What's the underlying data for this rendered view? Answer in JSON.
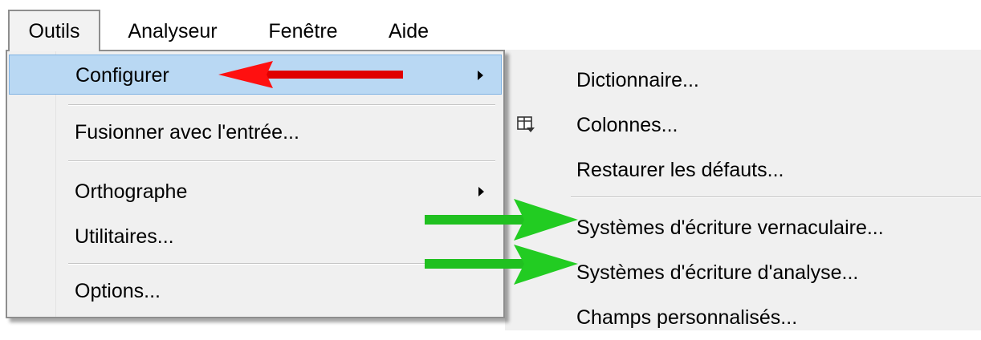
{
  "menubar": {
    "items": [
      {
        "label": "Outils"
      },
      {
        "label": "Analyseur"
      },
      {
        "label": "Fenêtre"
      },
      {
        "label": "Aide"
      }
    ]
  },
  "tools_menu": {
    "items": [
      {
        "label": "Configurer",
        "has_submenu": true,
        "highlighted": true
      },
      {
        "label": "Fusionner avec l'entrée..."
      },
      {
        "label": "Orthographe",
        "has_submenu": true
      },
      {
        "label": "Utilitaires..."
      },
      {
        "label": "Options..."
      }
    ]
  },
  "configure_submenu": {
    "items": [
      {
        "label": "Dictionnaire..."
      },
      {
        "label": "Colonnes...",
        "icon": "columns-icon"
      },
      {
        "label": "Restaurer les défauts..."
      },
      {
        "label": "Systèmes d'écriture vernaculaire..."
      },
      {
        "label": "Systèmes d'écriture d'analyse..."
      },
      {
        "label": "Champs personnalisés..."
      }
    ]
  },
  "annotations": {
    "red_arrow_color": "#ff0000",
    "green_arrow_color": "#22c61b"
  }
}
